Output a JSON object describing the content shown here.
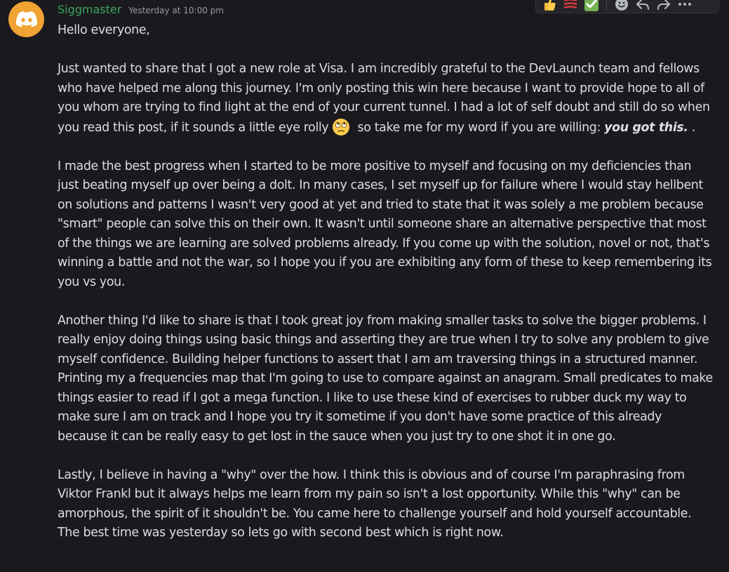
{
  "message": {
    "username": "Siggmaster",
    "timestamp": "Yesterday at 10:00 pm",
    "username_color": "#3ba55c",
    "avatar_color": "#f0a232",
    "avatar_icon": "discord-logo-icon",
    "greeting": "Hello everyone,",
    "para1_part1": "Just wanted to share that I got a new role at Visa.  I am incredibly grateful to the DevLaunch team and fellows who have helped me along this journey.  I'm only posting this win here because I want to provide hope to all of you whom are trying to find light at the end of your current tunnel.  I had a lot of self doubt and still do so when you read this post, if it sounds a little eye rolly",
    "para1_emoji": "eye-roll-emoji",
    "para1_part2": " so take me for my word if you are willing: ",
    "para1_emphasis": "you got this.",
    "para1_end": " .",
    "para2": "I made the best progress when I started to be more positive to myself and focusing on my deficiencies than just beating myself up over being a dolt.  In many cases, I set myself up for failure where I would stay hellbent on solutions and patterns I wasn't very good at yet and tried to state that it was solely a me problem because \"smart\" people can solve this on their own.  It wasn't until someone share an alternative perspective that most of the things we are learning are solved problems already.  If you come up with the solution, novel or not, that's winning a battle and not the war, so I hope you if you are exhibiting any form of these to keep remembering its you vs you.",
    "para3": "Another thing I'd like to share is that I took great joy from making smaller tasks to solve the bigger problems.  I really enjoy doing things using basic things and asserting they are true when I try to solve any problem to give myself confidence.  Building helper functions to assert that I am am traversing things in a structured manner.  Printing my a frequencies map that I'm going to use to compare against an anagram.  Small predicates to make things easier to read if I got a mega function.  I like to use these kind of exercises to rubber duck my way to make sure I am on track and I hope you try it sometime if you don't have some practice of this already because it can be really easy to get lost in the sauce when you just try to one shot it in one go.",
    "para4": "Lastly, I believe in having a \"why\" over the how.  I think this is obvious and of course I'm paraphrasing from Viktor Frankl but it always helps me learn from my pain so isn't a lost opportunity.  While this \"why\" can be amorphous, the spirit of it shouldn't be.  You came here to challenge yourself and hold yourself accountable.  The best time was yesterday so lets go with second best which is right now."
  },
  "toolbar": {
    "reactions": [
      "thumbs-up-icon",
      "red-lines-icon",
      "check-mark-icon"
    ],
    "actions": [
      "add-reaction-icon",
      "reply-icon",
      "forward-icon",
      "more-options-icon"
    ]
  }
}
